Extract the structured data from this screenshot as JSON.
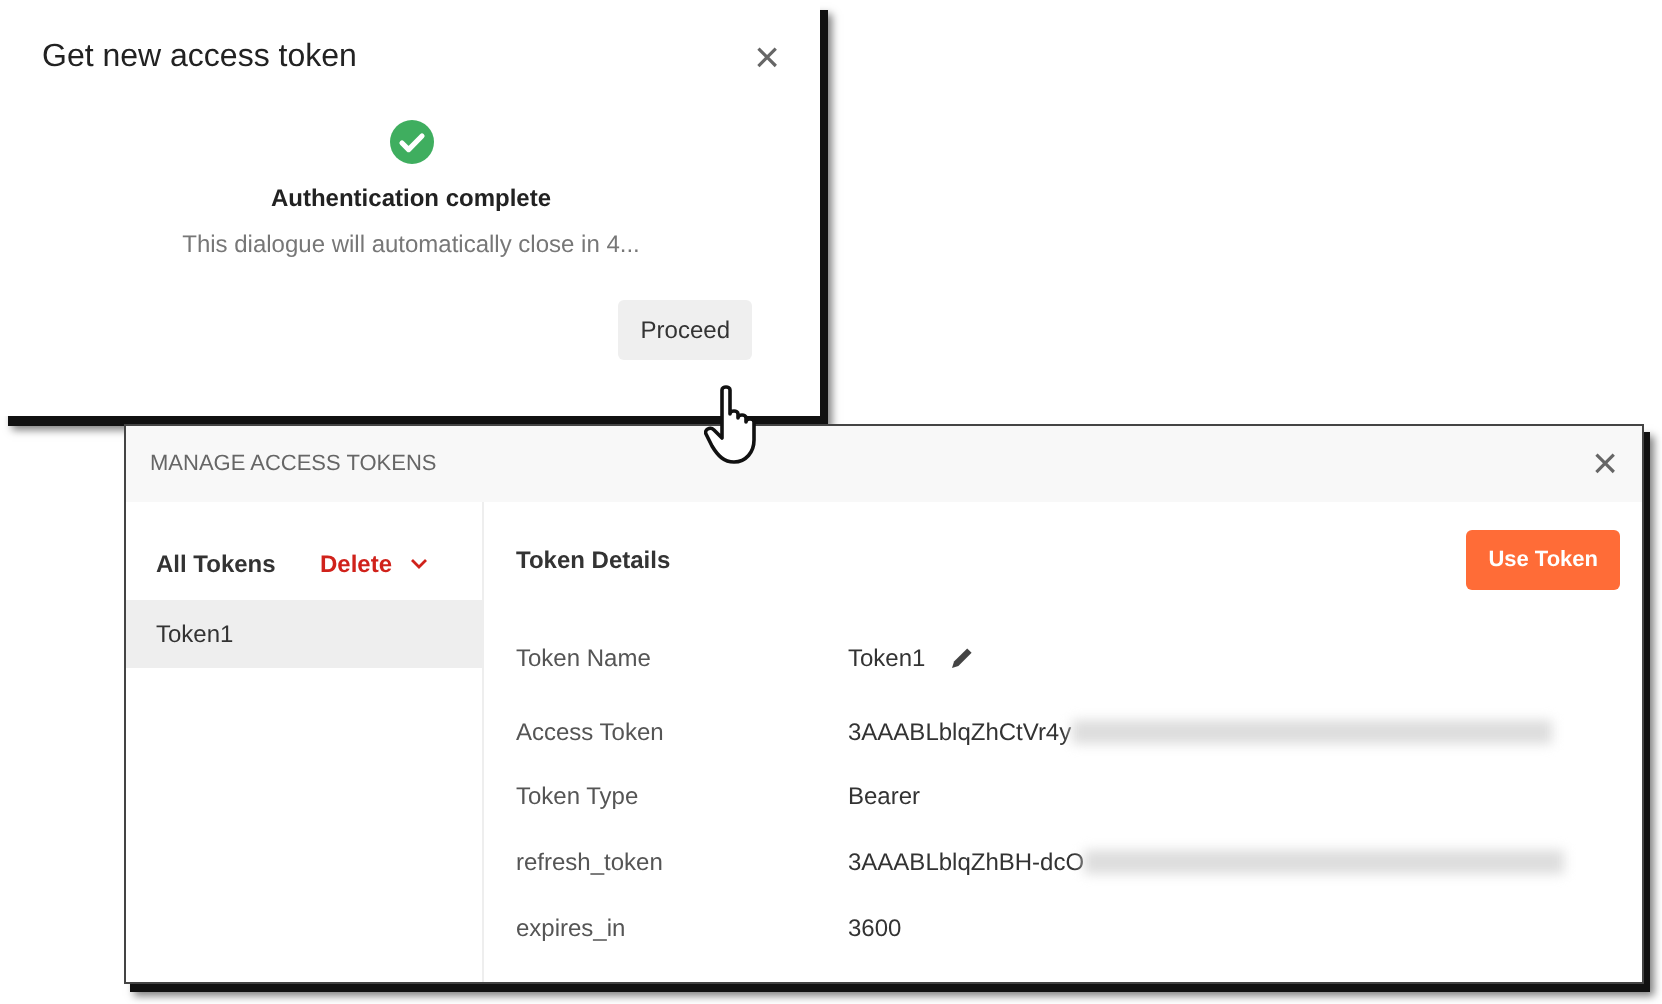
{
  "auth_dialog": {
    "title": "Get new access token",
    "close": "×",
    "status_title": "Authentication complete",
    "status_message": "This dialogue will automatically close in 4...",
    "proceed_button": "Proceed"
  },
  "manage_dialog": {
    "title": "MANAGE ACCESS TOKENS",
    "close": "×",
    "sidebar": {
      "heading": "All Tokens",
      "delete_label": "Delete",
      "tokens": [
        {
          "name": "Token1",
          "selected": true
        }
      ]
    },
    "details": {
      "heading": "Token Details",
      "use_button": "Use Token",
      "rows": [
        {
          "label": "Token Name",
          "value": "Token1",
          "kind": "editable"
        },
        {
          "label": "Access Token",
          "value": "3AAABLblqZhCtVr4y",
          "kind": "redacted"
        },
        {
          "label": "Token Type",
          "value": "Bearer",
          "kind": "plain"
        },
        {
          "label": "refresh_token",
          "value": "3AAABLblqZhBH-dcO",
          "kind": "redacted"
        },
        {
          "label": "expires_in",
          "value": "3600",
          "kind": "plain"
        }
      ]
    }
  }
}
